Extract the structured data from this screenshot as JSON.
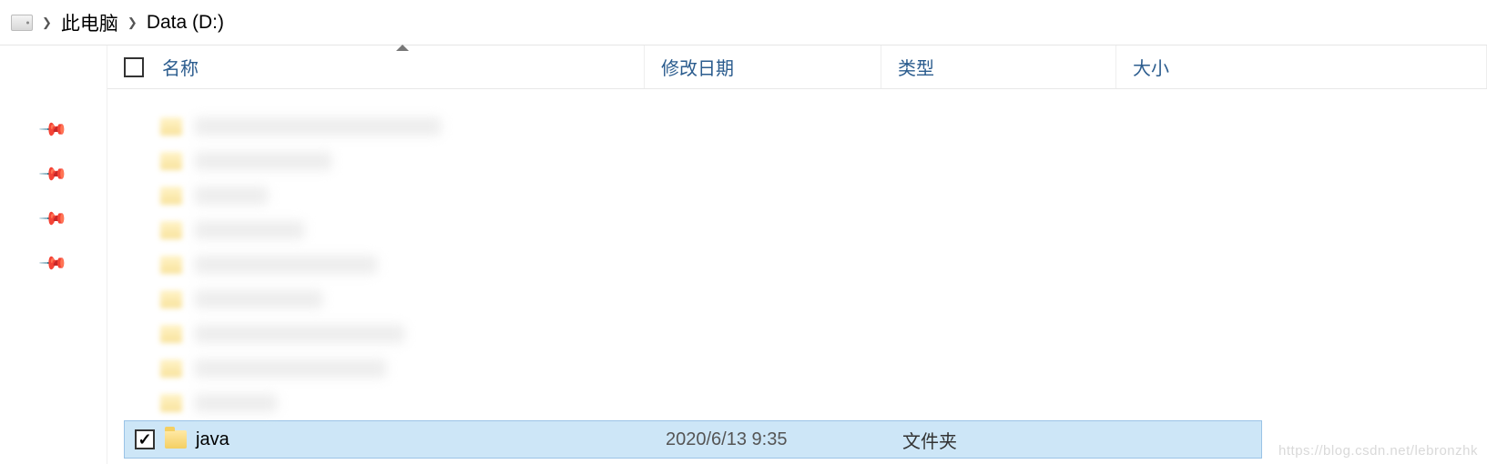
{
  "breadcrumb": {
    "items": [
      "此电脑",
      "Data (D:)"
    ]
  },
  "columns": {
    "name": "名称",
    "date": "修改日期",
    "type": "类型",
    "size": "大小"
  },
  "selected_row": {
    "name": "java",
    "date": "2020/6/13 9:35",
    "type": "文件夹",
    "checked": true
  },
  "blurred_row_count": 9,
  "sidebar_pin_count": 4,
  "watermark": "https://blog.csdn.net/lebronzhk"
}
